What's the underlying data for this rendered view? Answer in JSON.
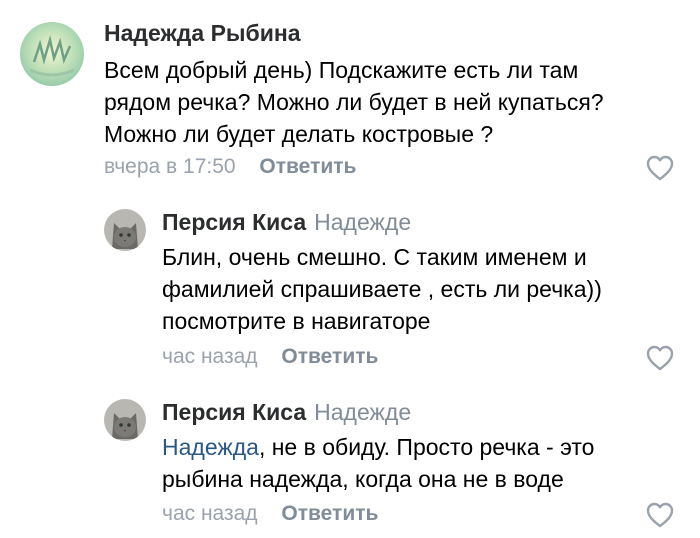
{
  "comments": [
    {
      "author": "Надежда Рыбина",
      "reply_to": "",
      "lines": [
        "Всем добрый день) Подскажите есть ли там",
        "рядом речка? Можно ли будет в ней купаться?",
        "Можно ли будет делать костровые ?"
      ],
      "time": "вчера в 17:50",
      "reply_label": "Ответить",
      "avatar_icon": "abstract-photo-avatar",
      "like_icon": "heart-outline-icon"
    },
    {
      "author": "Персия Киса",
      "reply_to": "Надежде",
      "lines": [
        "Блин, очень смешно. С таким именем и",
        "фамилией спрашиваете , есть ли речка))",
        "посмотрите в навигаторе"
      ],
      "time": "час назад",
      "reply_label": "Ответить",
      "avatar_icon": "grey-cat-avatar",
      "like_icon": "heart-outline-icon"
    },
    {
      "author": "Персия Киса",
      "reply_to": "Надежде",
      "mention": "Надежда",
      "line1_rest": ", не в обиду. Просто речка - это",
      "lines": [
        "рыбина надежда, когда она не в воде"
      ],
      "time": "час назад",
      "reply_label": "Ответить",
      "avatar_icon": "grey-cat-avatar",
      "like_icon": "heart-outline-icon"
    }
  ],
  "colors": {
    "author": "#2c2d2e",
    "secondary": "#818c99",
    "time": "#99a2ad",
    "link": "#2a5885",
    "text": "#000000"
  }
}
